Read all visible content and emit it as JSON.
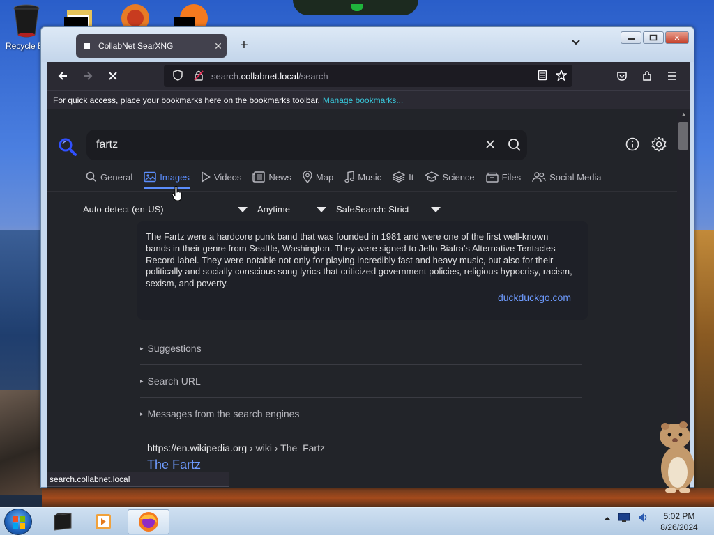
{
  "desktop": {
    "recycle_label": "Recycle B"
  },
  "window": {
    "tab_title": "CollabNet SearXNG",
    "new_tab_symbol": "+",
    "tab_list_symbol": "⌄",
    "controls": {
      "minimize": "▭",
      "maximize": "□",
      "close": "✕"
    }
  },
  "navbar": {
    "url_prefix": "search.",
    "url_domain": "collabnet.local",
    "url_path": "/search"
  },
  "bookmarks_bar": {
    "text": "For quick access, place your bookmarks here on the bookmarks toolbar.",
    "link": "Manage bookmarks..."
  },
  "search": {
    "query": "fartz",
    "clear_symbol": "✕"
  },
  "categories": [
    {
      "label": "General",
      "icon": "search-icon",
      "active": false
    },
    {
      "label": "Images",
      "icon": "image-icon",
      "active": true
    },
    {
      "label": "Videos",
      "icon": "play-icon",
      "active": false
    },
    {
      "label": "News",
      "icon": "newspaper-icon",
      "active": false
    },
    {
      "label": "Map",
      "icon": "pin-icon",
      "active": false
    },
    {
      "label": "Music",
      "icon": "music-icon",
      "active": false
    },
    {
      "label": "It",
      "icon": "layers-icon",
      "active": false
    },
    {
      "label": "Science",
      "icon": "school-icon",
      "active": false
    },
    {
      "label": "Files",
      "icon": "files-icon",
      "active": false
    },
    {
      "label": "Social Media",
      "icon": "people-icon",
      "active": false
    }
  ],
  "filters": {
    "language": "Auto-detect (en-US)",
    "time": "Anytime",
    "safesearch": "SafeSearch: Strict"
  },
  "infobox": {
    "text": "The Fartz were a hardcore punk band that was founded in 1981 and were one of the first well-known bands in their genre from Seattle, Washington. They were signed to Jello Biafra's Alternative Tentacles Record label. They were notable not only for playing incredibly fast and heavy music, but also for their politically and socially conscious song lyrics that criticized government policies, religious hypocrisy, racism, sexism, and poverty.",
    "source": "duckduckgo.com"
  },
  "sections": {
    "suggestions": "Suggestions",
    "search_url": "Search URL",
    "messages": "Messages from the search engines",
    "triangle": "▸"
  },
  "result": {
    "url_host": "https://en.wikipedia.org",
    "url_path": " › wiki › The_Fartz",
    "title": "The Fartz"
  },
  "status_bar": "search.collabnet.local",
  "taskbar": {
    "time": "5:02 PM",
    "date": "8/26/2024"
  },
  "colors": {
    "accent": "#5b8dfc",
    "link": "#6e9bff",
    "page_bg": "#222429"
  }
}
